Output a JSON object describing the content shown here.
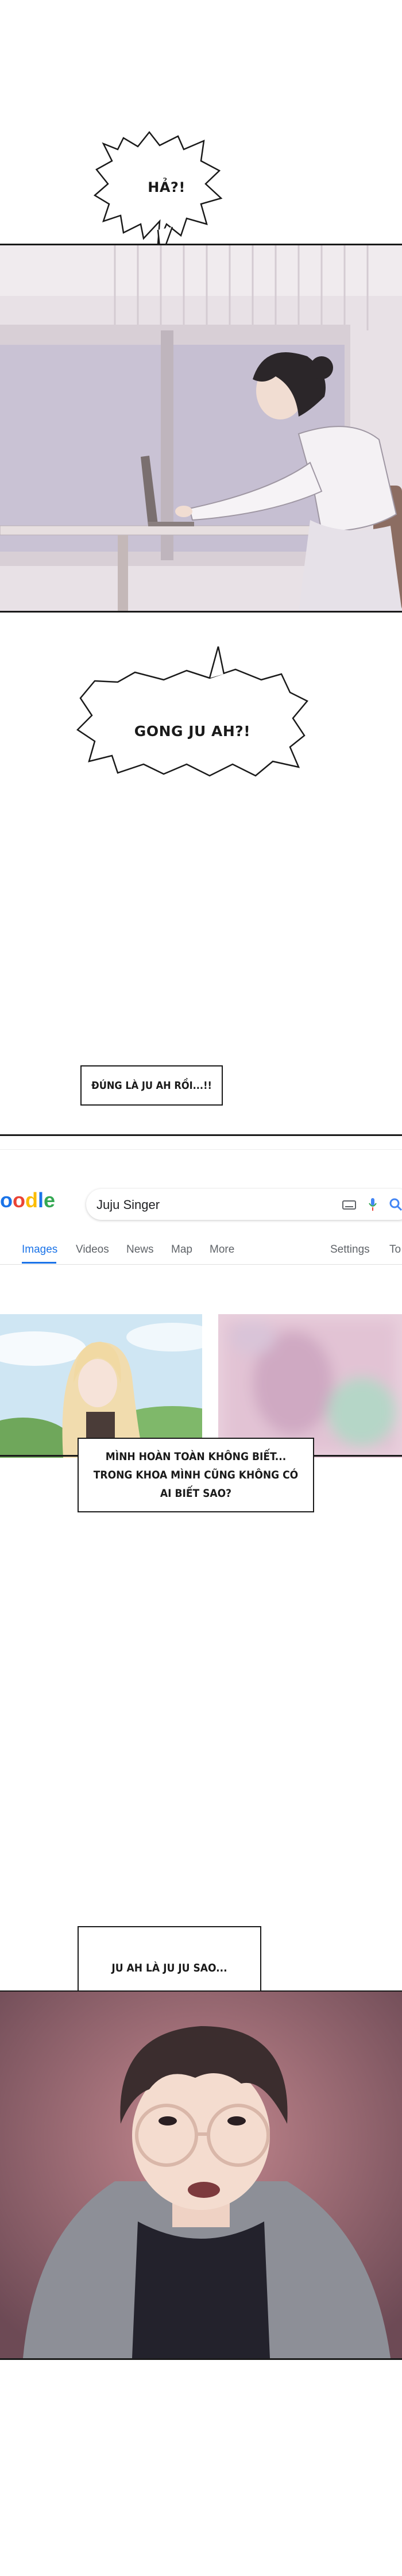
{
  "bubbles": {
    "b1": "HẢ?!",
    "b2": "GONG JU AH?!"
  },
  "captions": {
    "c1": "ĐÚNG LÀ JU AH RỒI...!!",
    "c2": "MÌNH HOÀN TOÀN KHÔNG BIẾT... TRONG KHOA MÌNH CŨNG KHÔNG CÓ AI BIẾT SAO?",
    "c3": "JU AH LÀ JU JU SAO..."
  },
  "search": {
    "logo": "oodle",
    "query": "Juju Singer",
    "tabs": [
      "Images",
      "Videos",
      "News",
      "Map",
      "More"
    ],
    "settings": "Settings",
    "tools": "To"
  },
  "icons": [
    "keyboard-icon",
    "mic-icon",
    "search-icon"
  ]
}
